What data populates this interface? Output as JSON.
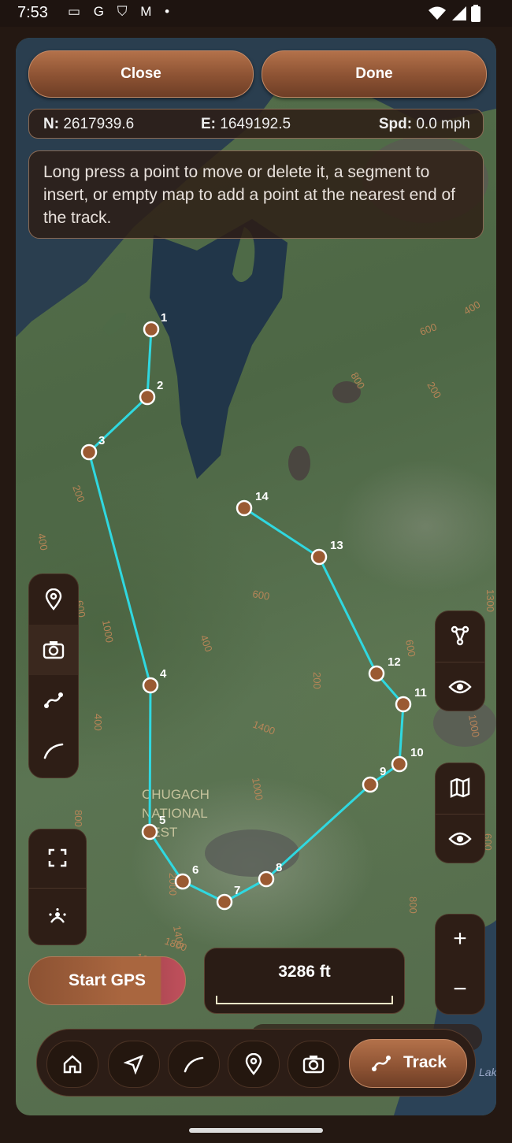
{
  "status_bar": {
    "time": "7:53",
    "icons": [
      "cast-icon",
      "google-icon",
      "shield-icon",
      "gmail-icon",
      "dot-icon"
    ],
    "right_icons": [
      "wifi-icon",
      "signal-icon",
      "battery-icon"
    ]
  },
  "top_buttons": {
    "close_label": "Close",
    "done_label": "Done"
  },
  "coords": {
    "n_label": "N:",
    "n_value": "2617939.6",
    "e_label": "E:",
    "e_value": "1649192.5",
    "spd_label": "Spd:",
    "spd_value": "0.0 mph"
  },
  "info_text": "Long press a point to move or delete it, a segment to insert, or empty map to add a point at the nearest end of the track.",
  "map": {
    "area_label_lines": [
      "CHUGACH",
      "NATIONAL",
      "REST"
    ],
    "track_color": "#2fd8e0",
    "point_color": "#9a5a32",
    "point_labels": [
      "1",
      "2",
      "3",
      "4",
      "5",
      "6",
      "7",
      "8",
      "9",
      "10",
      "11",
      "12",
      "13",
      "14"
    ],
    "contour_labels": [
      "400",
      "600",
      "800",
      "200",
      "600",
      "200",
      "400",
      "1200",
      "1000",
      "600",
      "400",
      "200",
      "1400",
      "400",
      "800",
      "1000",
      "1200",
      "1400",
      "1800",
      "1600",
      "2000",
      "600",
      "1000",
      "1200",
      "800",
      "400",
      "600",
      "1300"
    ]
  },
  "left_toolbar": [
    "location-pin-icon",
    "camera-icon",
    "track-icon",
    "curve-icon"
  ],
  "left_toolbar2": [
    "fullscreen-icon",
    "locate-me-icon"
  ],
  "right_toolbar": [
    "waypoints-icon",
    "eye-icon"
  ],
  "right_toolbar2": [
    "map-icon",
    "eye-icon"
  ],
  "zoom": {
    "in": "+",
    "out": "−"
  },
  "gps_button": "Start GPS",
  "scale_text": "3286 ft",
  "bottom_nav": {
    "items": [
      "home-icon",
      "navigate-icon",
      "curve-icon",
      "location-pin-icon",
      "camera-icon"
    ],
    "active_label": "Track"
  },
  "map_corner_text": "Lak",
  "colors": {
    "accent": "#a9663f",
    "panel": "#2e1e16",
    "track": "#2fd8e0"
  }
}
